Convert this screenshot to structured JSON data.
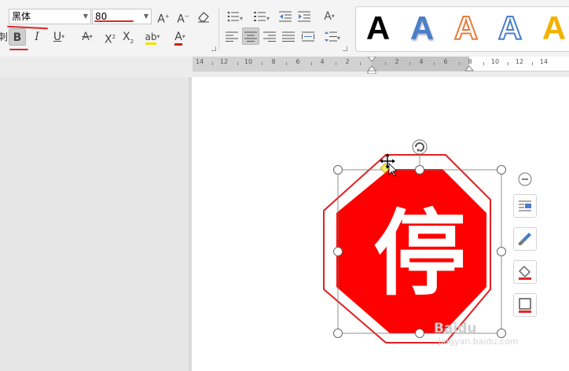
{
  "toolbar": {
    "font_name": "黑体",
    "font_size": "80",
    "grow_font": "A",
    "shrink_font": "A",
    "bold": "B",
    "italic": "I",
    "underline": "U",
    "strikethrough": "A",
    "superscript": "X",
    "subscript": "X",
    "highlight": "ab",
    "font_color": "A",
    "text_direction": "A",
    "side_label": "刺"
  },
  "text_styles": [
    "A",
    "A",
    "A",
    "A",
    "A"
  ],
  "ruler_numbers": [
    "14",
    "12",
    "10",
    "8",
    "6",
    "4",
    "2",
    "2",
    "4",
    "6",
    "8",
    "10",
    "12",
    "14"
  ],
  "shape": {
    "text": "停",
    "fill": "#ff0000",
    "outline": "#e02020"
  },
  "watermark": {
    "main": "Baidu",
    "sub": "jingyan.baidu.com"
  },
  "colors": {
    "annotation_red": "#e0262b",
    "font_color_bar": "#d81e06",
    "style_blue": "#4a7ec8",
    "style_orange": "#e87b3c",
    "style_gold": "#f2b200"
  },
  "icons": [
    "grow-font-icon",
    "shrink-font-icon",
    "clear-format-icon",
    "bullet-list-icon",
    "numbered-list-icon",
    "decrease-indent-icon",
    "increase-indent-icon",
    "align-left-icon",
    "align-center-icon",
    "align-right-icon",
    "justify-icon",
    "distribute-icon",
    "line-spacing-icon",
    "rotate-handle-icon",
    "move-cursor-icon",
    "collapse-icon",
    "wrap-text-icon",
    "style-brush-icon",
    "shape-fill-icon",
    "shape-outline-icon"
  ]
}
